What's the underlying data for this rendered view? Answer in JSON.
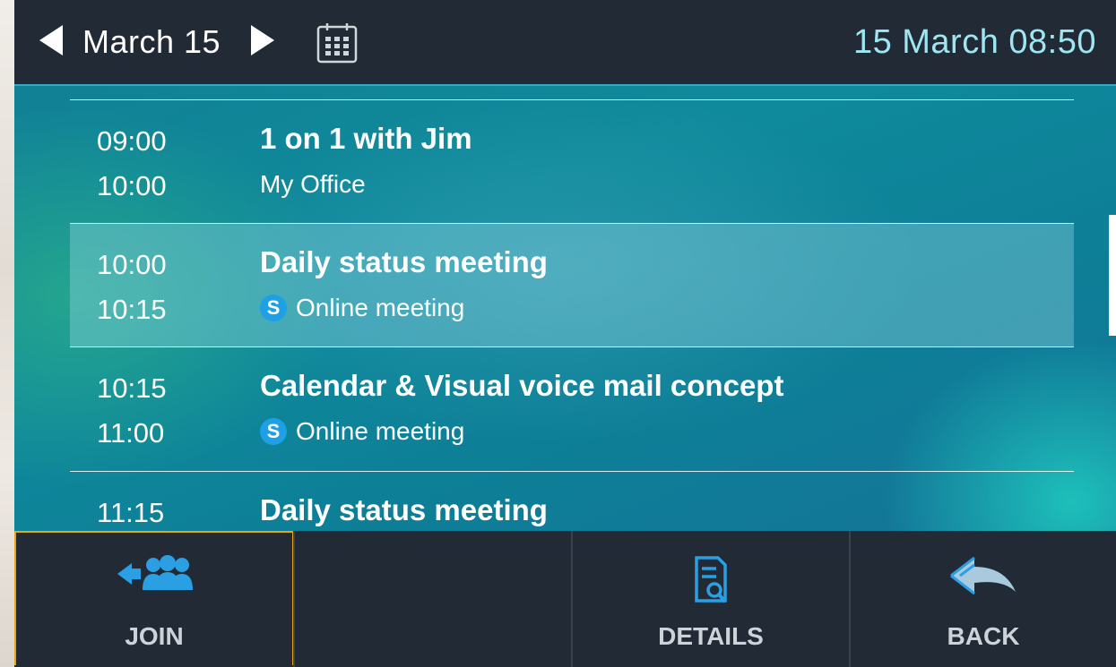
{
  "header": {
    "date_label": "March 15",
    "clock": "15 March 08:50"
  },
  "meetings": [
    {
      "start": "09:00",
      "end": "10:00",
      "title": "1 on 1 with Jim",
      "subtitle": "My Office",
      "online": false
    },
    {
      "start": "10:00",
      "end": "10:15",
      "title": "Daily status meeting",
      "subtitle": "Online meeting",
      "online": true
    },
    {
      "start": "10:15",
      "end": "11:00",
      "title": "Calendar & Visual voice mail concept",
      "subtitle": "Online meeting",
      "online": true
    },
    {
      "start": "11:15",
      "end": "",
      "title": "Daily status meeting",
      "subtitle": "",
      "online": false
    }
  ],
  "online_badge": "S",
  "softkeys": {
    "join": "JOIN",
    "details": "DETAILS",
    "back": "BACK"
  },
  "colors": {
    "bar_background": "#222b35",
    "clock_text": "#9fe6f3",
    "focus_border": "#e8a417",
    "icon_blue": "#2b9fe3"
  }
}
